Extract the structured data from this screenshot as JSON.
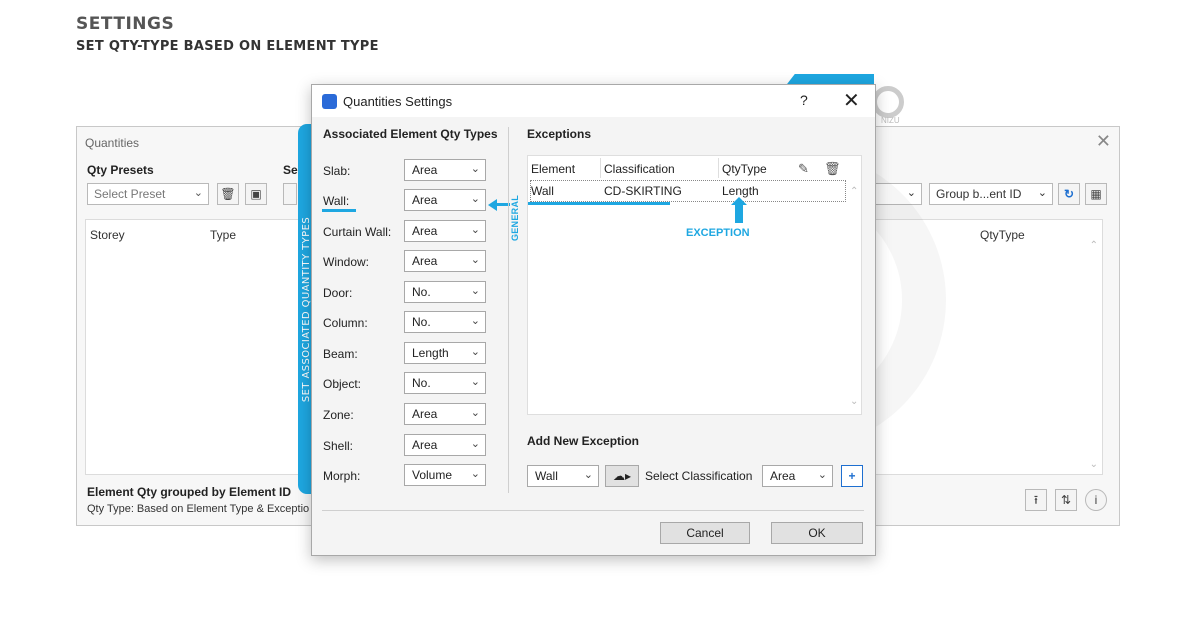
{
  "header": {
    "title": "SETTINGS",
    "subtitle": "SET QTY-TYPE BASED ON ELEMENT TYPE"
  },
  "colors": {
    "accent": "#1ea7e1",
    "window_bg": "#f4f4f4",
    "border": "#a8a8a8"
  },
  "background_window": {
    "title": "Quantities",
    "qty_presets_label": "Qty Presets",
    "select_label_partial": "Sel",
    "preset_placeholder": "Select Preset",
    "group_select": "Group b...ent ID",
    "columns": [
      "Storey",
      "Type",
      "QtyType"
    ],
    "footer_title": "Element Qty grouped by Element ID",
    "footer_text": "Qty Type: Based on Element Type & Exceptio",
    "icons": [
      "trash-icon",
      "add-preset-icon",
      "refresh-icon",
      "tree-icon",
      "export-icon",
      "adjust-icon",
      "info-icon",
      "close-icon"
    ]
  },
  "watermark": {
    "text": "NIZU"
  },
  "side_label": "SET ASSOCIATED QUANTITY TYPES",
  "dialog": {
    "title": "Quantities Settings",
    "help": "?",
    "close": "✕",
    "left_section_title": "Associated Element Qty Types",
    "rows": [
      {
        "label": "Slab:",
        "value": "Area"
      },
      {
        "label": "Wall:",
        "value": "Area"
      },
      {
        "label": "Curtain Wall:",
        "value": "Area"
      },
      {
        "label": "Window:",
        "value": "Area"
      },
      {
        "label": "Door:",
        "value": "No."
      },
      {
        "label": "Column:",
        "value": "No."
      },
      {
        "label": "Beam:",
        "value": "Length"
      },
      {
        "label": "Object:",
        "value": "No."
      },
      {
        "label": "Zone:",
        "value": "Area"
      },
      {
        "label": "Shell:",
        "value": "Area"
      },
      {
        "label": "Morph:",
        "value": "Volume"
      }
    ],
    "general_label": "GENERAL",
    "exceptions_title": "Exceptions",
    "exceptions_columns": [
      "Element",
      "Classification",
      "QtyType"
    ],
    "exceptions_rows": [
      {
        "element": "Wall",
        "classification": "CD-SKIRTING",
        "qty_type": "Length"
      }
    ],
    "exception_callout": "EXCEPTION",
    "add_exception_title": "Add New Exception",
    "add_element_value": "Wall",
    "select_classification_label": "Select Classification",
    "add_qty_value": "Area",
    "cancel_label": "Cancel",
    "ok_label": "OK"
  }
}
